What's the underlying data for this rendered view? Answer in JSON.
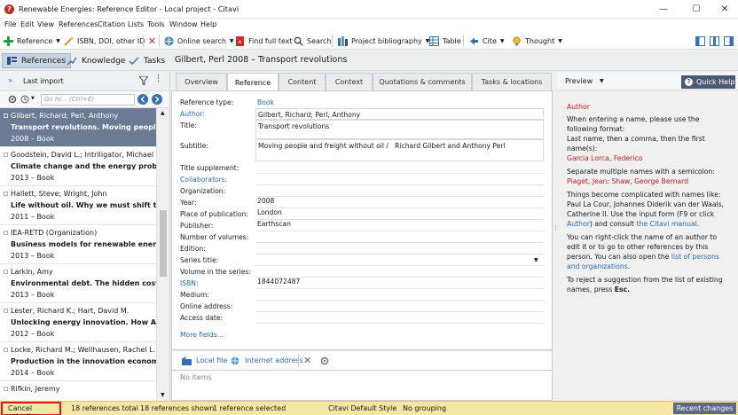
{
  "window": {
    "title": "Renewable Energies: Reference Editor - Local project - Citavi"
  },
  "menu": [
    "File",
    "Edit",
    "View",
    "References",
    "Citation",
    "Lists",
    "Tools",
    "Window",
    "Help"
  ],
  "toolbar": {
    "reference": "Reference",
    "isbn": "ISBN, DOI, other ID",
    "online_search": "Online search",
    "full_text": "Find full text",
    "search": "Search",
    "project_bibliography": "Project bibliography",
    "table": "Table",
    "cite": "Cite",
    "thought": "Thought"
  },
  "nav": {
    "references": "References",
    "knowledge": "Knowledge",
    "tasks": "Tasks"
  },
  "reference_header": "Gilbert, Perl 2008 – Transport revolutions",
  "left": {
    "list_title": "Last import",
    "search_placeholder": "Go to... (Ctrl+E)",
    "items": [
      {
        "authors": "Gilbert, Richard; Perl, Anthony",
        "title": "Transport revolutions. Moving people and",
        "meta": "2008 – Book",
        "selected": true
      },
      {
        "authors": "Goodstein, David L.; Intriligator, Michael D.",
        "title": "Climate change and the energy problem.",
        "meta": "2013 – Book"
      },
      {
        "authors": "Hallett, Steve; Wright, John",
        "title": "Life without oil. Why we must shift to a n",
        "meta": "2011 – Book"
      },
      {
        "authors": "IEA-RETD (Organization)",
        "title": "Business models for renewable energy in",
        "meta": "2013 – Book"
      },
      {
        "authors": "Larkin, Amy",
        "title": "Environmental debt. The hidden costs of a",
        "meta": "2013 – Book"
      },
      {
        "authors": "Lester, Richard K.; Hart, David M.",
        "title": "Unlocking energy innovation. How Ameri",
        "meta": "2012 – Book"
      },
      {
        "authors": "Locke, Richard M.; Wellhausen, Rachel L.",
        "title": "Production in the innovation economy",
        "meta": "2014 – Book"
      },
      {
        "authors": "Rifkin, Jeremy",
        "title": "",
        "meta": ""
      }
    ]
  },
  "tabs": [
    "Overview",
    "Reference",
    "Content",
    "Context",
    "Quotations & comments",
    "Tasks & locations"
  ],
  "form": {
    "reference_type_label": "Reference type:",
    "reference_type_value": "Book",
    "author_label": "Author:",
    "author_value": "Gilbert, Richard; Perl, Anthony",
    "title_label": "Title:",
    "title_value": "Transport revolutions",
    "subtitle_label": "Subtitle:",
    "subtitle_value": "Moving people and freight without oil /   Richard Gilbert and Anthony Perl",
    "title_supplement_label": "Title supplement:",
    "collaborators_label": "Collaborators:",
    "organization_label": "Organization:",
    "year_label": "Year:",
    "year_value": "2008",
    "place_label": "Place of publication:",
    "place_value": "London",
    "publisher_label": "Publisher:",
    "publisher_value": "Earthscan",
    "volumes_label": "Number of volumes:",
    "edition_label": "Edition:",
    "series_label": "Series title:",
    "volume_series_label": "Volume in the series:",
    "isbn_label": "ISBN:",
    "isbn_value": "1844072487",
    "medium_label": "Medium:",
    "online_address_label": "Online address:",
    "access_date_label": "Access date:",
    "more_fields": "More fields..."
  },
  "attachments": {
    "local_file": "Local file",
    "internet_address": "Internet address",
    "no_items": "No items"
  },
  "right": {
    "preview": "Preview",
    "quick_help": "Quick Help",
    "help_title": "Author",
    "help_intro": "When entering a name, please use the following format:",
    "help_format": "Last name, then a comma, then the first name(s):",
    "help_example1": "Garcia Lorca, Federico",
    "help_multi": "Separate multiple names with a semicolon:",
    "help_example2": "Piaget, Jean; Shaw, George Bernard",
    "help_complicated_pre": "Things become complicated with names like: Paul La Cour, Johannes Diderik van der Waals, Catherine II. Use the input form (F9 or click ",
    "help_author_link": "Author",
    "help_complicated_post": ") and consult ",
    "help_manual_link": "the Citavi manual",
    "help_right_click_pre": "You can right-click the name of an author to edit it or to go to other references by this person. You can also open the ",
    "help_list_link": "list of persons and organizations",
    "help_reject": "To reject a suggestion from the list of existing names, press ",
    "help_esc": "Esc."
  },
  "status": {
    "cancel_selection": "Cancel selection",
    "total": "18 references total",
    "shown": "18 references shown",
    "selected": "1 reference selected",
    "style": "Citavi Default Style",
    "grouping": "No grouping",
    "recent_changes": "Recent changes"
  },
  "colors": {
    "selected_row": "#6b7b94",
    "link": "#2a6bb3",
    "help_red": "#c8201d",
    "statusbar": "#f5e6a4"
  }
}
